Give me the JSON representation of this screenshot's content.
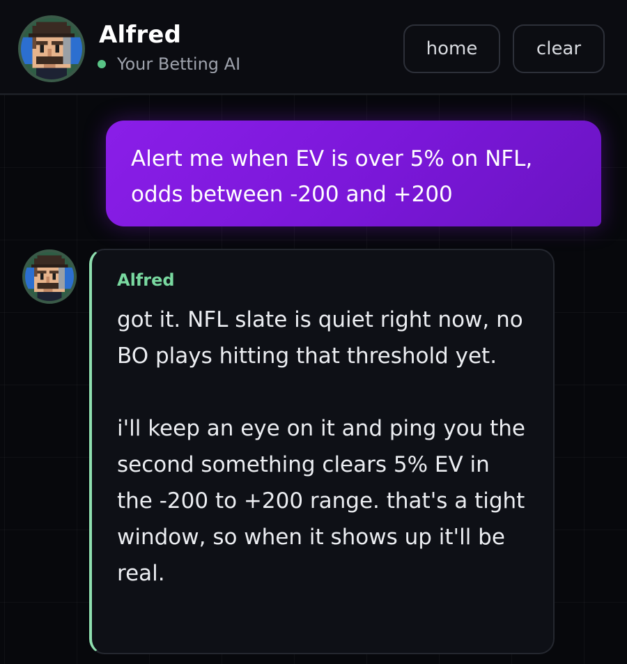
{
  "header": {
    "name": "Alfred",
    "subtitle": "Your Betting AI",
    "status_color": "#59c486",
    "avatar_icon": "pixel-gentleman-avatar-icon",
    "buttons": {
      "home": "home",
      "clear": "clear"
    }
  },
  "messages": [
    {
      "role": "user",
      "text": "Alert me when EV is over 5% on NFL, odds between -200 and +200"
    },
    {
      "role": "assistant",
      "sender": "Alfred",
      "paragraphs": [
        "got it. NFL slate is quiet right now, no BO plays hitting that threshold yet.",
        "i'll keep an eye on it and ping you the second something clears 5% EV in the -200 to +200 range. that's a tight window, so when it shows up it'll be real."
      ]
    }
  ],
  "colors": {
    "user_bubble": "#8a1ee8",
    "assistant_accent": "#8fe0b0",
    "assistant_name": "#79d9a0",
    "background": "#07080c"
  }
}
